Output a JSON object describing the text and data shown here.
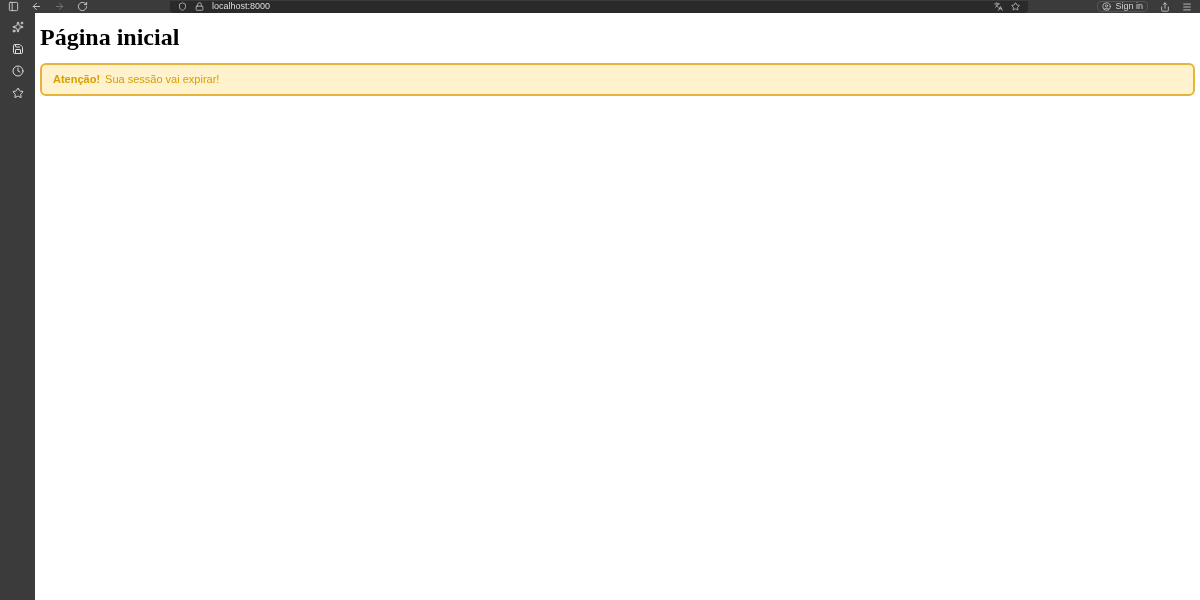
{
  "browser": {
    "address": "localhost:8000",
    "sign_in": "Sign in"
  },
  "page": {
    "title": "Página inicial",
    "alert": {
      "kind": "warning",
      "label": "Atenção!",
      "message": "Sua sessão vai expirar!"
    }
  }
}
